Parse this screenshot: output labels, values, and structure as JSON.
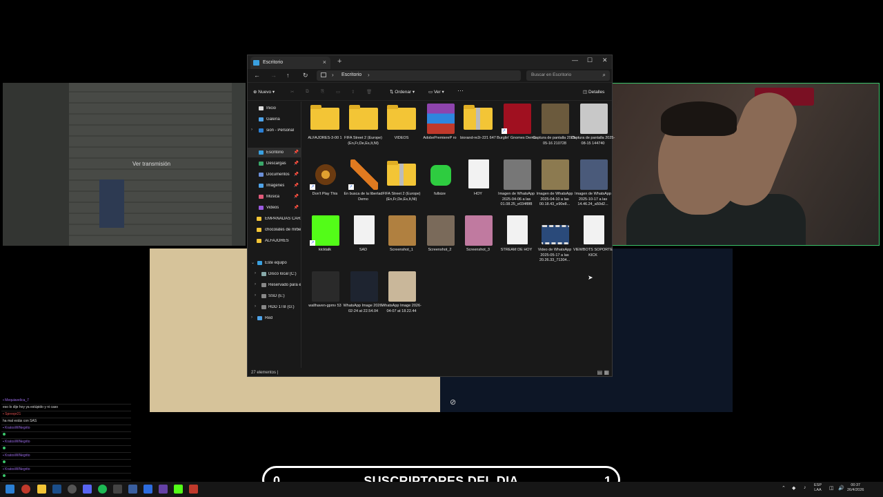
{
  "stream": {
    "game_overlay_label": "Ver transmisión",
    "subscribers": {
      "left_count": "0",
      "label": "SUSCRIPTORES DEL DIA",
      "right_count": "1"
    },
    "chat": [
      {
        "user": "Mequiavelica_7",
        "text": "eso lo dije hoy ya estúpido y ni caso",
        "color": "#9b6be8"
      },
      {
        "user": "Sprevpr21",
        "text": "ha mal estás con SAS",
        "color": "#e05252"
      },
      {
        "user": "KratosWiNegrito",
        "text": "",
        "color": "#9b6be8"
      },
      {
        "user": "KratosWiNegrito",
        "text": "",
        "color": "#9b6be8"
      },
      {
        "user": "KratosWiNegrito",
        "text": "",
        "color": "#9b6be8"
      },
      {
        "user": "KratosWiNegrito",
        "text": "",
        "color": "#9b6be8"
      }
    ]
  },
  "explorer": {
    "tab_title": "Escritorio",
    "breadcrumb": "Escritorio",
    "search_placeholder": "Buscar en Escritorio",
    "toolbar": {
      "new": "Nuevo",
      "sort": "Ordenar",
      "view": "Ver",
      "more": "···",
      "details": "Detalles"
    },
    "sidebar": {
      "home": "Inicio",
      "gallery": "Galería",
      "onedrive": "sion - Personal",
      "desktop": "Escritorio",
      "downloads": "Descargas",
      "documents": "Documentos",
      "pictures": "Imágenes",
      "music": "Música",
      "videos": "Videos",
      "empanadas": "EMPANADAS CARA",
      "chocolates": "chocolates de mrbe",
      "alfajores": "ALFAJORES",
      "this_pc": "Este equipo",
      "drive_c": "Disco local (C:)",
      "reserved": "Reservado para el",
      "ssd": "SSD (E:)",
      "hdd": "HDD 1TB (G:)",
      "network": "Red"
    },
    "files": [
      {
        "name": "ALFAJORES-3-00 1",
        "kind": "folder"
      },
      {
        "name": "FIFA Street 2 (Europe) (En,Fr,De,Es,It,Nl)",
        "kind": "folder"
      },
      {
        "name": "VIDEOS",
        "kind": "folder"
      },
      {
        "name": "AdobePremiereP ro",
        "kind": "winrar"
      },
      {
        "name": "biorand-re2r-221 647",
        "kind": "zip"
      },
      {
        "name": "Burglin' Gnomes Demo",
        "kind": "gnome"
      },
      {
        "name": "Captura de pantalla 2025-05-16 210728",
        "kind": "photo-a"
      },
      {
        "name": "Captura de pantalla 2025-08-15 144740",
        "kind": "photo-b"
      },
      {
        "name": "Don't Play This",
        "kind": "eye"
      },
      {
        "name": "En busca de la libertad Demo",
        "kind": "sword"
      },
      {
        "name": "FIFA Street 2 (Europe) (En,Fr,De,Es,It,Nl)",
        "kind": "zip"
      },
      {
        "name": "fullsize",
        "kind": "green"
      },
      {
        "name": "HOY",
        "kind": "doc"
      },
      {
        "name": "Imagen de WhatsApp 2025-04-06 a las 01.08.25_e034f8f8",
        "kind": "photo-c"
      },
      {
        "name": "Imagen de WhatsApp 2025-04-10 a las 00.18.43_e90e8...",
        "kind": "photo-d"
      },
      {
        "name": "Imagen de WhatsApp 2025-10-17 a las 14.46.24_a50d2...",
        "kind": "photo-e"
      },
      {
        "name": "kicktalk",
        "kind": "kick"
      },
      {
        "name": "SAD",
        "kind": "doc"
      },
      {
        "name": "Screenshot_1",
        "kind": "photo-f"
      },
      {
        "name": "Screenshot_2",
        "kind": "photo-g"
      },
      {
        "name": "Screenshot_3",
        "kind": "photo-h"
      },
      {
        "name": "STREAM DE HOY",
        "kind": "doc"
      },
      {
        "name": "Video de WhatsApp 2025-05-17 a las 20.26.33_71304...",
        "kind": "video"
      },
      {
        "name": "VIEWBOTS SOPORTE KICK",
        "kind": "doc"
      },
      {
        "name": "wallhaven-gpmv 53",
        "kind": "photo-i"
      },
      {
        "name": "WhatsApp Image 2026-02-24 at 22.54.04",
        "kind": "photo-j"
      },
      {
        "name": "WhatsApp Image 2026-04-07 at 18.22.44",
        "kind": "photo-k"
      }
    ],
    "status": "27 elementos  |"
  },
  "taskbar": {
    "lang": "ESP\nLAA",
    "time": "00:37",
    "date": "26/4/2026"
  }
}
